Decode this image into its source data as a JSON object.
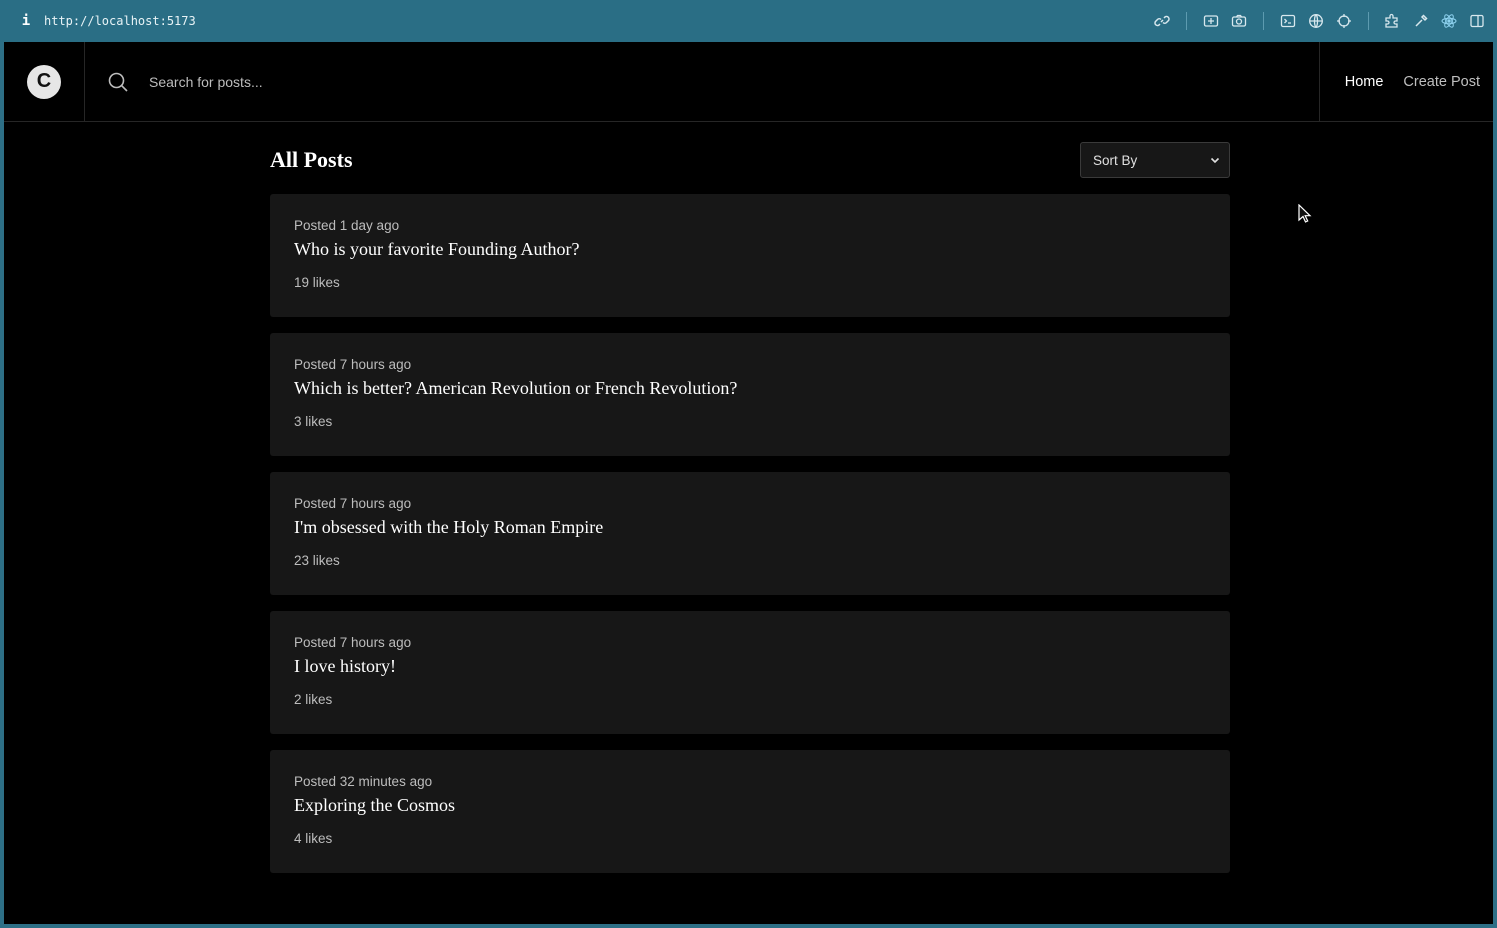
{
  "browser": {
    "info_glyph": "i",
    "url": "http://localhost:5173",
    "toolbar_icons": [
      "link-icon",
      "screenshot-icon",
      "camera-icon",
      "terminal-icon",
      "globe-icon",
      "crosshair-icon",
      "extension-icon",
      "eyedropper-icon",
      "react-icon",
      "sidebar-icon"
    ]
  },
  "header": {
    "logo_letter": "C",
    "search": {
      "placeholder": "Search for posts...",
      "value": ""
    },
    "nav": {
      "home": "Home",
      "create_post": "Create Post"
    }
  },
  "main": {
    "title": "All Posts",
    "sort": {
      "label": "Sort By"
    },
    "posts": [
      {
        "time": "Posted 1 day ago",
        "title": "Who is your favorite Founding Author?",
        "likes": "19 likes"
      },
      {
        "time": "Posted 7 hours ago",
        "title": "Which is better? American Revolution or French Revolution?",
        "likes": "3 likes"
      },
      {
        "time": "Posted 7 hours ago",
        "title": "I'm obsessed with the Holy Roman Empire",
        "likes": "23 likes"
      },
      {
        "time": "Posted 7 hours ago",
        "title": "I love history!",
        "likes": "2 likes"
      },
      {
        "time": "Posted 32 minutes ago",
        "title": "Exploring the Cosmos",
        "likes": "4 likes"
      }
    ]
  },
  "colors": {
    "chrome": "#2a6e85",
    "background": "#000000",
    "card": "#171717",
    "text_primary": "#ffffff",
    "text_muted": "#bdbdbd"
  }
}
